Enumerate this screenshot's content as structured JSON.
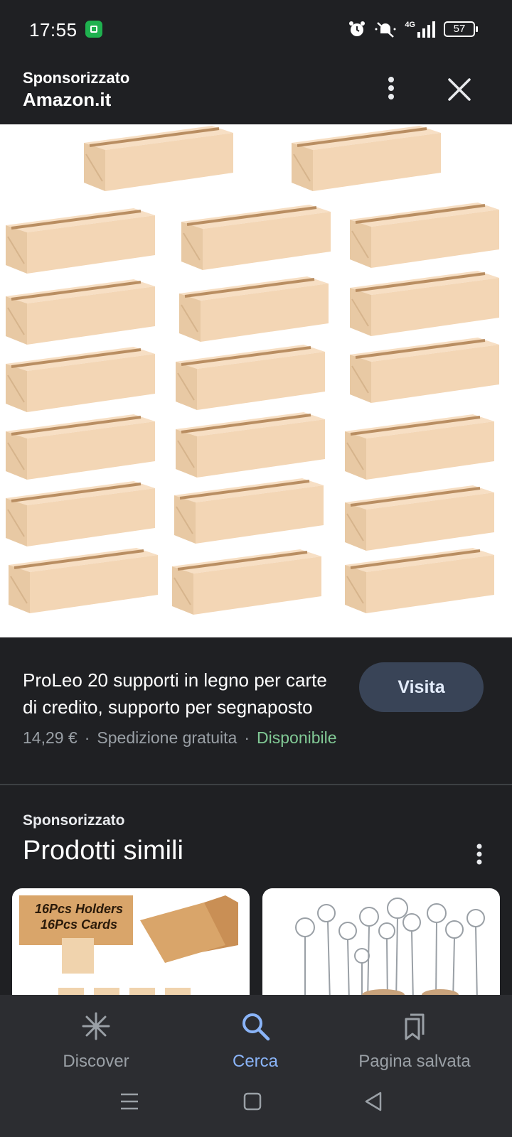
{
  "status_bar": {
    "time": "17:55",
    "network": "4G",
    "battery": "57"
  },
  "ad_header": {
    "sponsored_label": "Sponsorizzato",
    "merchant": "Amazon.it"
  },
  "product": {
    "title": "ProLeo 20 supporti in legno per carte di credito, supporto per segnaposto",
    "price": "14,29 €",
    "shipping": "Spedizione gratuita",
    "availability": "Disponibile",
    "visit_label": "Visita"
  },
  "similar": {
    "sponsored_label": "Sponsorizzato",
    "title": "Prodotti simili",
    "cards": [
      {
        "badge_line1": "16Pcs Holders",
        "badge_line2": "16Pcs Cards"
      },
      {
        "image": "wire-photo-holders"
      }
    ]
  },
  "bottom_nav": {
    "items": [
      {
        "label": "Discover",
        "icon": "asterisk-icon"
      },
      {
        "label": "Cerca",
        "icon": "search-icon",
        "active": true
      },
      {
        "label": "Pagina salvata",
        "icon": "bookmarks-icon"
      }
    ]
  },
  "colors": {
    "background": "#1f2023",
    "nav_background": "#2c2d31",
    "accent": "#8ab4f8",
    "available": "#81c995",
    "visit_button": "#394457"
  }
}
